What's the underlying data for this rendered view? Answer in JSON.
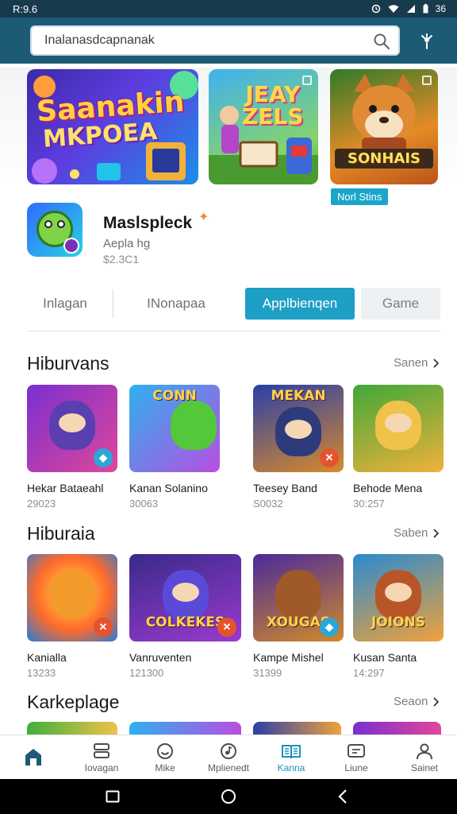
{
  "status_bar": {
    "time": "R:9.6",
    "battery": "36"
  },
  "search": {
    "value": "Inalanasdcapnanak",
    "search_icon": "search-icon",
    "filter_icon": "filter-icon"
  },
  "banners": [
    {
      "title": "Saanakin",
      "subtitle": "MKPOEA"
    },
    {
      "title_line1": "JEAY",
      "title_line2": "ZELS"
    },
    {
      "title": "SONHAIS"
    }
  ],
  "banner_badge": "Norl Stins",
  "featured": {
    "name": "Maslspleck",
    "subtitle": "Aepla hg",
    "price": "$2.3C1"
  },
  "tabs": [
    {
      "label": "Inlagan"
    },
    {
      "label": "INonapaa"
    },
    {
      "label": "Applbienqen",
      "active": true
    },
    {
      "label": "Game"
    }
  ],
  "sections": [
    {
      "title": "Hiburvans",
      "see_all": "Sanen",
      "cards": [
        {
          "title": "Hekar Bataeahl",
          "meta": "29023",
          "word": "",
          "tag_color": "#2aa7d8"
        },
        {
          "title": "Kanan Solanino",
          "meta": "30063",
          "word": "CONN",
          "tag_color": ""
        },
        {
          "title": "Teesey Band",
          "meta": "S0032",
          "word": "MEKAN",
          "tag_color": "#e5532e"
        },
        {
          "title": "Behode Mena",
          "meta": "30:257",
          "word": "",
          "tag_color": ""
        }
      ]
    },
    {
      "title": "Hiburaia",
      "see_all": "Saben",
      "cards": [
        {
          "title": "Kanialla",
          "meta": "13233",
          "word": "",
          "tag_color": "#e5532e"
        },
        {
          "title": "Vanruventen",
          "meta": "121300",
          "word": "COLKEKES",
          "tag_color": "#e5532e"
        },
        {
          "title": "Kampe Mishel",
          "meta": "31399",
          "word": "XOUGAS",
          "tag_color": "#2aa7d8"
        },
        {
          "title": "Kusan Santa",
          "meta": "14:297",
          "word": "JOIONS",
          "tag_color": ""
        }
      ]
    },
    {
      "title": "Karkeplage",
      "see_all": "Seaon"
    }
  ],
  "bottom_nav": [
    {
      "label": "",
      "icon": "home-icon",
      "active": true
    },
    {
      "label": "Iovagan",
      "icon": "apps-icon"
    },
    {
      "label": "Mike",
      "icon": "smile-icon"
    },
    {
      "label": "Mplienedt",
      "icon": "music-icon"
    },
    {
      "label": "Kanna",
      "icon": "book-icon",
      "active": true
    },
    {
      "label": "Liune",
      "icon": "message-icon"
    },
    {
      "label": "Sainet",
      "icon": "person-icon"
    }
  ],
  "system_nav": [
    "back-icon",
    "home-circle-icon",
    "recent-icon"
  ]
}
